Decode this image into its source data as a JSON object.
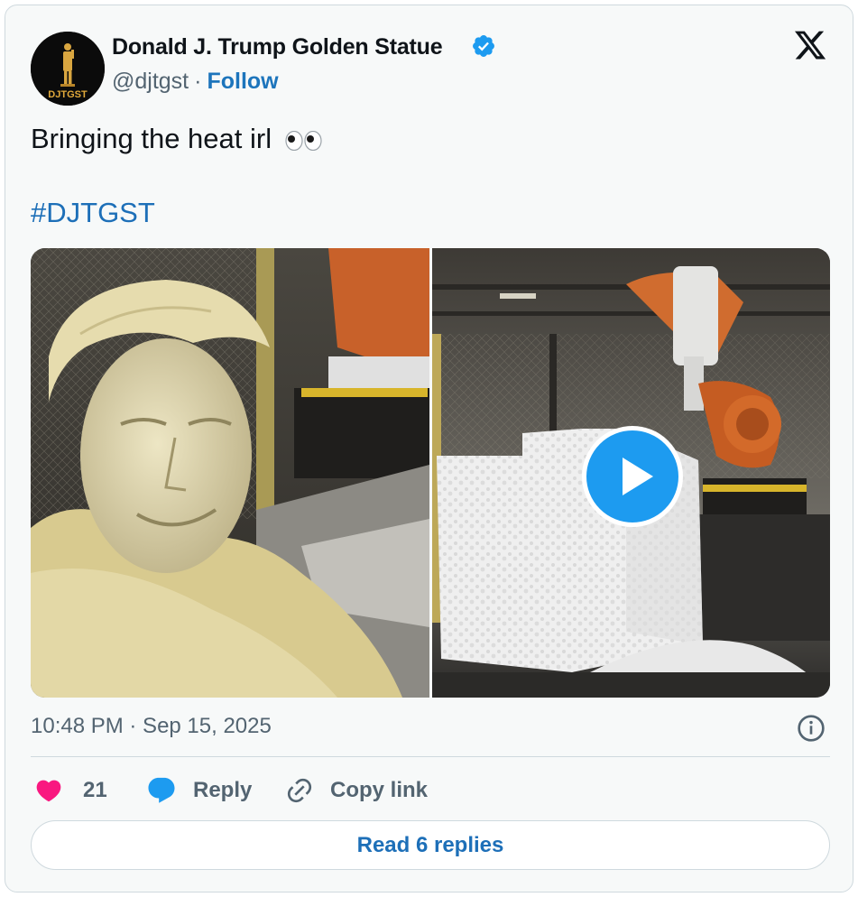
{
  "author": {
    "display_name": "Donald J. Trump Golden Statue",
    "handle": "@djtgst",
    "separator": "·",
    "follow_label": "Follow",
    "avatar_text": "DJTGST",
    "verified": true
  },
  "tweet": {
    "text": "Bringing the heat irl",
    "emoji": "eyes",
    "hashtag": "#DJTGST"
  },
  "media": {
    "type": "video",
    "panels": [
      "foam-bust-close-up",
      "robot-carving-foam-block"
    ]
  },
  "meta": {
    "timestamp": "10:48 PM · Sep 15, 2025"
  },
  "actions": {
    "like_count": "21",
    "reply_label": "Reply",
    "copy_link_label": "Copy link"
  },
  "footer": {
    "read_replies_label": "Read 6 replies"
  },
  "colors": {
    "link": "#1d6fb8",
    "like": "#f91880",
    "reply_icon": "#1d9bf0",
    "muted": "#536471",
    "card_bg": "#f7f9f9"
  }
}
